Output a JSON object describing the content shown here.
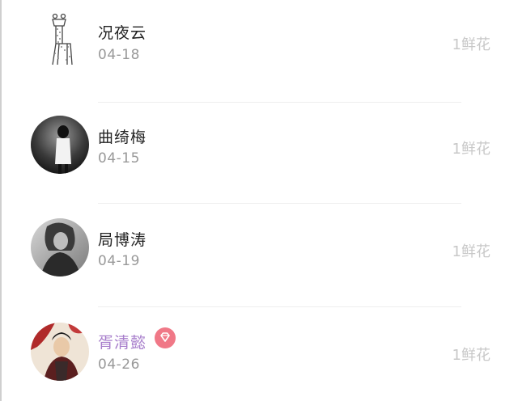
{
  "list": {
    "items": [
      {
        "name": "况夜云",
        "date": "04-18",
        "gift": "1鲜花",
        "avatar_icon": "giraffe-avatar-icon"
      },
      {
        "name": "曲绮梅",
        "date": "04-15",
        "gift": "1鲜花",
        "avatar_icon": "photo-avatar"
      },
      {
        "name": "局博涛",
        "date": "04-19",
        "gift": "1鲜花",
        "avatar_icon": "photo-avatar"
      },
      {
        "name": "胥清懿",
        "date": "04-26",
        "gift": "1鲜花",
        "avatar_icon": "photo-avatar",
        "badge_icon": "diamond-icon"
      }
    ]
  },
  "colors": {
    "name": "#222222",
    "vip_name": "#a77dcb",
    "date": "#999999",
    "gift": "#c8c8c8",
    "badge": "#f07887",
    "divider": "#eeeeee"
  }
}
